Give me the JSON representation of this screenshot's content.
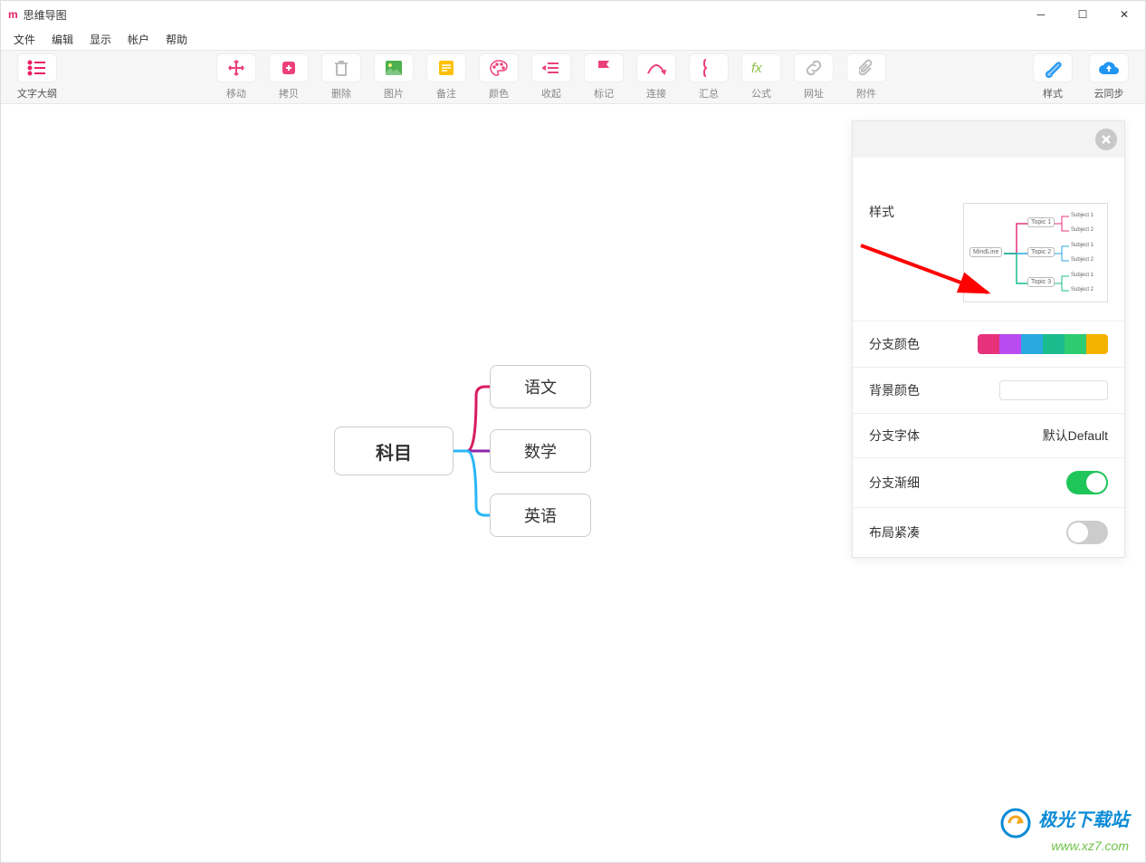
{
  "window": {
    "title": "思维导图",
    "icon_letter": "m"
  },
  "menus": [
    "文件",
    "编辑",
    "显示",
    "帐户",
    "帮助"
  ],
  "toolbar_left": {
    "label": "文字大纲"
  },
  "toolbar_main": [
    {
      "label": "移动"
    },
    {
      "label": "拷贝"
    },
    {
      "label": "删除"
    },
    {
      "label": "图片"
    },
    {
      "label": "备注"
    },
    {
      "label": "颜色"
    },
    {
      "label": "收起"
    },
    {
      "label": "标记"
    },
    {
      "label": "连接"
    },
    {
      "label": "汇总"
    },
    {
      "label": "公式"
    },
    {
      "label": "网址"
    },
    {
      "label": "附件"
    }
  ],
  "toolbar_right": [
    {
      "label": "样式"
    },
    {
      "label": "云同步"
    }
  ],
  "mindmap": {
    "root": "科目",
    "children": [
      "语文",
      "数学",
      "英语"
    ],
    "branch_colors": [
      "#d81b60",
      "#8e24aa",
      "#29b6f6"
    ]
  },
  "panel": {
    "style_label": "样式",
    "preview": {
      "root": "MindLine",
      "topics": [
        "Topic 1",
        "Topic 2",
        "Topic 3"
      ],
      "subjects": [
        "Subject 1",
        "Subject 2"
      ]
    },
    "branch_color_label": "分支颜色",
    "branch_colors": [
      "#e6327a",
      "#b84cf0",
      "#2aa9e0",
      "#1abc8e",
      "#2ecc71",
      "#f5b301"
    ],
    "bg_color_label": "背景颜色",
    "font_label": "分支字体",
    "font_value": "默认Default",
    "taper_label": "分支渐细",
    "taper_on": true,
    "compact_label": "布局紧凑",
    "compact_on": false
  },
  "watermark": {
    "line1": "极光下载站",
    "line2": "www.xz7.com"
  }
}
